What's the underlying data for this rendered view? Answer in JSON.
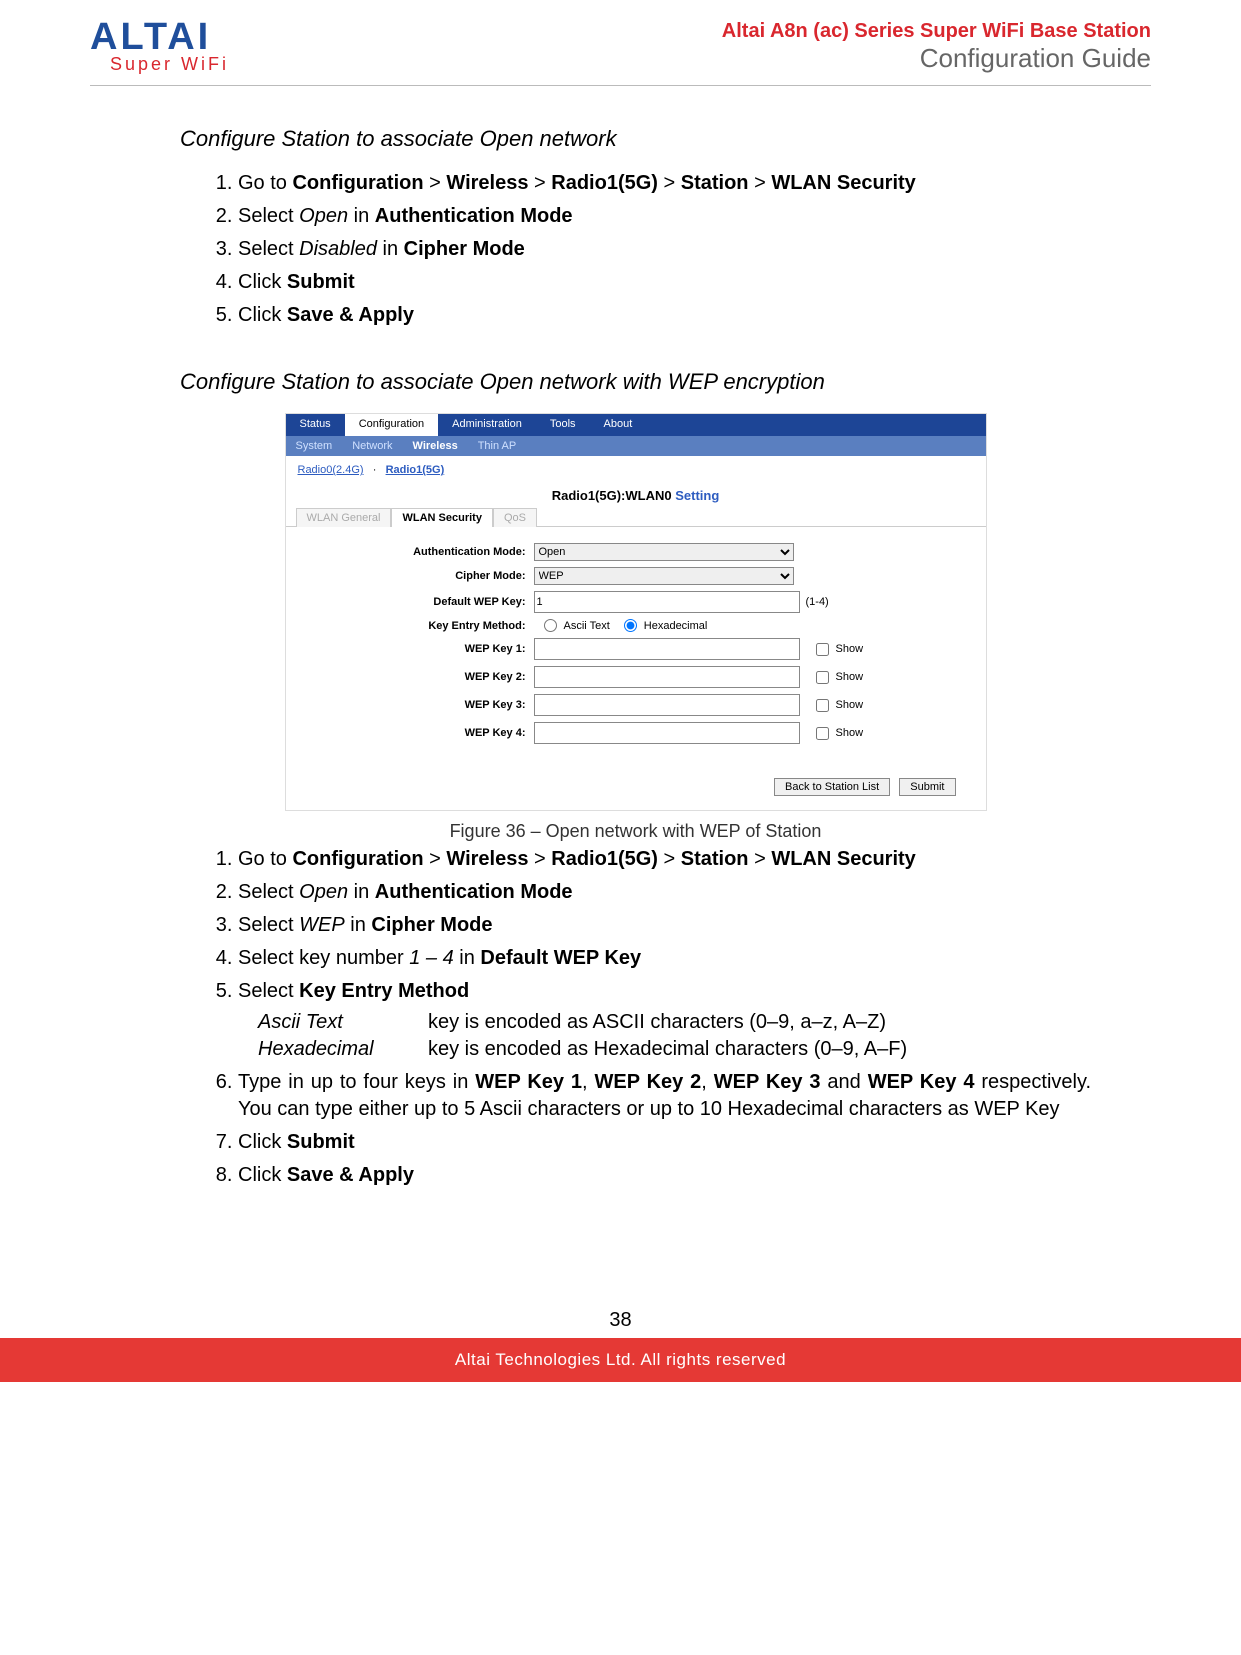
{
  "header": {
    "logo_main": "ALTAI",
    "logo_sub": "Super WiFi",
    "title_line1": "Altai A8n (ac) Series Super WiFi Base Station",
    "title_line2": "Configuration Guide"
  },
  "section1": {
    "heading": "Configure Station to associate Open network",
    "steps": {
      "s1_pre": "Go to ",
      "s1_b1": "Configuration",
      "s1_gt1": " > ",
      "s1_b2": "Wireless",
      "s1_gt2": " > ",
      "s1_b3": "Radio1(5G)",
      "s1_gt3": " > ",
      "s1_b4": "Station",
      "s1_gt4": " > ",
      "s1_b5": "WLAN Security",
      "s2_pre": "Select ",
      "s2_i": "Open",
      "s2_mid": " in ",
      "s2_b": "Authentication Mode",
      "s3_pre": "Select ",
      "s3_i": "Disabled",
      "s3_mid": " in ",
      "s3_b": "Cipher Mode",
      "s4_pre": "Click ",
      "s4_b": "Submit",
      "s5_pre": "Click ",
      "s5_b": "Save & Apply"
    }
  },
  "section2": {
    "heading": "Configure Station to associate Open network with WEP encryption",
    "figcap": "Figure 36 – Open network with WEP of Station",
    "steps": {
      "s1_pre": "Go to ",
      "s1_b1": "Configuration",
      "s1_gt1": " > ",
      "s1_b2": "Wireless",
      "s1_gt2": " > ",
      "s1_b3": "Radio1(5G)",
      "s1_gt3": " > ",
      "s1_b4": "Station",
      "s1_gt4": " > ",
      "s1_b5": "WLAN Security",
      "s2_pre": "Select ",
      "s2_i": "Open",
      "s2_mid": " in ",
      "s2_b": "Authentication Mode",
      "s3_pre": "Select ",
      "s3_i": "WEP",
      "s3_mid": " in ",
      "s3_b": "Cipher Mode",
      "s4_pre": "Select key number ",
      "s4_i": "1 – 4",
      "s4_mid": " in ",
      "s4_b": "Default WEP Key",
      "s5_pre": "Select ",
      "s5_b": "Key Entry Method",
      "s5_row1_term": "Ascii Text",
      "s5_row1_desc": "key is encoded as ASCII characters (0–9, a–z, A–Z)",
      "s5_row2_term": "Hexadecimal",
      "s5_row2_desc": "key is encoded as Hexadecimal characters (0–9, A–F)",
      "s6_pre": "Type in up to four keys in ",
      "s6_b1": "WEP Key 1",
      "s6_c1": ", ",
      "s6_b2": "WEP Key 2",
      "s6_c2": ", ",
      "s6_b3": "WEP Key 3",
      "s6_c3": " and ",
      "s6_b4": "WEP Key 4",
      "s6_rest": " respectively. You can type either up to 5 Ascii characters or up to 10 Hexadecimal characters as WEP Key",
      "s7_pre": "Click ",
      "s7_b": "Submit",
      "s8_pre": "Click ",
      "s8_b": "Save & Apply"
    }
  },
  "screenshot": {
    "top_tabs": [
      "Status",
      "Configuration",
      "Administration",
      "Tools",
      "About"
    ],
    "top_active": "Configuration",
    "sub_tabs": [
      "System",
      "Network",
      "Wireless",
      "Thin AP"
    ],
    "sub_active": "Wireless",
    "radio_link_1": "Radio0(2.4G)",
    "radio_sep": "·",
    "radio_link_2": "Radio1(5G)",
    "title_black": "Radio1(5G):WLAN0",
    "title_blue": " Setting",
    "tabs2": [
      "WLAN General",
      "WLAN Security",
      "QoS"
    ],
    "tabs2_active": "WLAN Security",
    "labels": {
      "auth": "Authentication Mode:",
      "cipher": "Cipher Mode:",
      "defkey": "Default WEP Key:",
      "method": "Key Entry Method:",
      "k1": "WEP Key 1:",
      "k2": "WEP Key 2:",
      "k3": "WEP Key 3:",
      "k4": "WEP Key 4:"
    },
    "auth_value": "Open",
    "cipher_value": "WEP",
    "defkey_value": "1",
    "defkey_hint": "(1-4)",
    "method_opt1": "Ascii Text",
    "method_opt2": "Hexadecimal",
    "show": "Show",
    "btn_back": "Back to Station List",
    "btn_submit": "Submit"
  },
  "footer": {
    "page_num": "38",
    "bar": "Altai Technologies Ltd. All rights reserved"
  }
}
